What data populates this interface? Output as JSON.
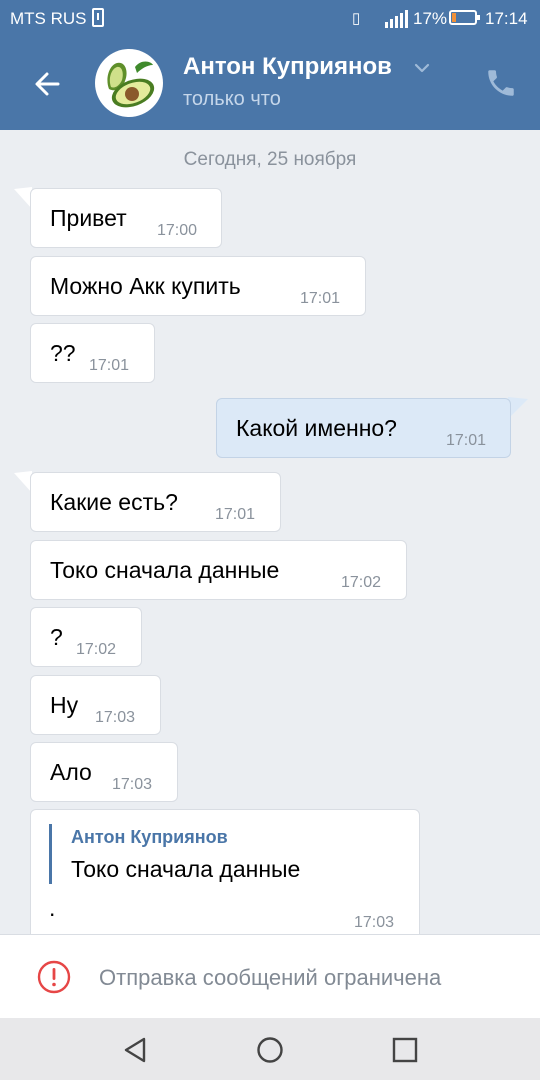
{
  "status_bar": {
    "carrier": "MTS RUS",
    "battery_percent": "17%",
    "battery_level": 0.17,
    "time": "17:14"
  },
  "header": {
    "contact_name": "Антон Куприянов",
    "last_seen": "только что"
  },
  "chat": {
    "date_divider": "Сегодня, 25 ноября",
    "messages": [
      {
        "text": "Привет",
        "time": "17:00",
        "direction": "in"
      },
      {
        "text": "Можно Акк купить",
        "time": "17:01",
        "direction": "in"
      },
      {
        "text": "??",
        "time": "17:01",
        "direction": "in"
      },
      {
        "text": "Какой именно?",
        "time": "17:01",
        "direction": "out"
      },
      {
        "text": "Какие есть?",
        "time": "17:01",
        "direction": "in"
      },
      {
        "text": "Токо сначала данные",
        "time": "17:02",
        "direction": "in"
      },
      {
        "text": "?",
        "time": "17:02",
        "direction": "in"
      },
      {
        "text": "Ну",
        "time": "17:03",
        "direction": "in"
      },
      {
        "text": "Ало",
        "time": "17:03",
        "direction": "in"
      }
    ],
    "reply_message": {
      "quoted_author": "Антон Куприянов",
      "quoted_text": "Токо сначала данные",
      "text": ".",
      "time": "17:03"
    }
  },
  "restriction": {
    "label": "Отправка сообщений ограничена"
  },
  "colors": {
    "header_bg": "#4a76a8",
    "outgoing_bubble": "#dce9f7",
    "chat_bg": "#ebeef2",
    "error_red": "#e64646"
  },
  "icons": [
    "back-arrow-icon",
    "chevron-down-icon",
    "phone-icon",
    "alert-icon",
    "nav-back-icon",
    "nav-home-icon",
    "nav-recents-icon"
  ]
}
